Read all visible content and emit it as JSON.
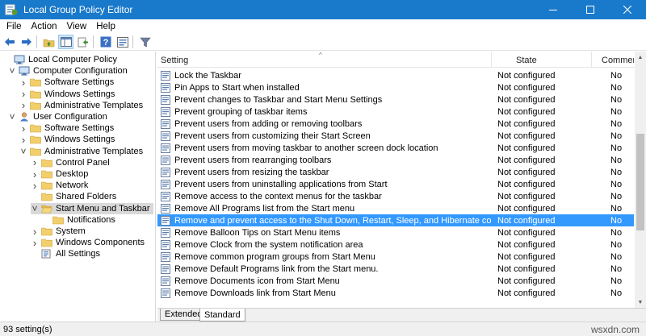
{
  "window": {
    "title": "Local Group Policy Editor"
  },
  "menu": [
    "File",
    "Action",
    "View",
    "Help"
  ],
  "toolbar_icons": [
    "back-icon",
    "forward-icon",
    "folder-up-icon",
    "show-hide-tree-icon",
    "export-list-icon",
    "help-icon",
    "properties-icon",
    "filter-icon"
  ],
  "tree": [
    {
      "label": "Local Computer Policy",
      "level": 0,
      "arrow": "",
      "icon": "computer",
      "selected": false
    },
    {
      "label": "Computer Configuration",
      "level": 1,
      "arrow": "open",
      "icon": "computer",
      "selected": false
    },
    {
      "label": "Software Settings",
      "level": 2,
      "arrow": "closed",
      "icon": "folder",
      "selected": false
    },
    {
      "label": "Windows Settings",
      "level": 2,
      "arrow": "closed",
      "icon": "folder",
      "selected": false
    },
    {
      "label": "Administrative Templates",
      "level": 2,
      "arrow": "closed",
      "icon": "folder",
      "selected": false
    },
    {
      "label": "User Configuration",
      "level": 1,
      "arrow": "open",
      "icon": "user",
      "selected": false
    },
    {
      "label": "Software Settings",
      "level": 2,
      "arrow": "closed",
      "icon": "folder",
      "selected": false
    },
    {
      "label": "Windows Settings",
      "level": 2,
      "arrow": "closed",
      "icon": "folder",
      "selected": false
    },
    {
      "label": "Administrative Templates",
      "level": 2,
      "arrow": "open",
      "icon": "folder",
      "selected": false
    },
    {
      "label": "Control Panel",
      "level": 3,
      "arrow": "closed",
      "icon": "folder",
      "selected": false
    },
    {
      "label": "Desktop",
      "level": 3,
      "arrow": "closed",
      "icon": "folder",
      "selected": false
    },
    {
      "label": "Network",
      "level": 3,
      "arrow": "closed",
      "icon": "folder",
      "selected": false
    },
    {
      "label": "Shared Folders",
      "level": 3,
      "arrow": "",
      "icon": "folder",
      "selected": false
    },
    {
      "label": "Start Menu and Taskbar",
      "level": 3,
      "arrow": "open",
      "icon": "folder-open",
      "selected": true
    },
    {
      "label": "Notifications",
      "level": 4,
      "arrow": "",
      "icon": "folder",
      "selected": false
    },
    {
      "label": "System",
      "level": 3,
      "arrow": "closed",
      "icon": "folder",
      "selected": false
    },
    {
      "label": "Windows Components",
      "level": 3,
      "arrow": "closed",
      "icon": "folder",
      "selected": false
    },
    {
      "label": "All Settings",
      "level": 3,
      "arrow": "",
      "icon": "all-settings",
      "selected": false
    }
  ],
  "columns": {
    "setting": "Setting",
    "state": "State",
    "comment": "Commen"
  },
  "rows": [
    {
      "setting": "Lock the Taskbar",
      "state": "Not configured",
      "comment": "No",
      "selected": false
    },
    {
      "setting": "Pin Apps to Start when installed",
      "state": "Not configured",
      "comment": "No",
      "selected": false
    },
    {
      "setting": "Prevent changes to Taskbar and Start Menu Settings",
      "state": "Not configured",
      "comment": "No",
      "selected": false
    },
    {
      "setting": "Prevent grouping of taskbar items",
      "state": "Not configured",
      "comment": "No",
      "selected": false
    },
    {
      "setting": "Prevent users from adding or removing toolbars",
      "state": "Not configured",
      "comment": "No",
      "selected": false
    },
    {
      "setting": "Prevent users from customizing their Start Screen",
      "state": "Not configured",
      "comment": "No",
      "selected": false
    },
    {
      "setting": "Prevent users from moving taskbar to another screen dock location",
      "state": "Not configured",
      "comment": "No",
      "selected": false
    },
    {
      "setting": "Prevent users from rearranging toolbars",
      "state": "Not configured",
      "comment": "No",
      "selected": false
    },
    {
      "setting": "Prevent users from resizing the taskbar",
      "state": "Not configured",
      "comment": "No",
      "selected": false
    },
    {
      "setting": "Prevent users from uninstalling applications from Start",
      "state": "Not configured",
      "comment": "No",
      "selected": false
    },
    {
      "setting": "Remove access to the context menus for the taskbar",
      "state": "Not configured",
      "comment": "No",
      "selected": false
    },
    {
      "setting": "Remove All Programs list from the Start menu",
      "state": "Not configured",
      "comment": "No",
      "selected": false
    },
    {
      "setting": "Remove and prevent access to the Shut Down, Restart, Sleep, and Hibernate commands",
      "state": "Not configured",
      "comment": "No",
      "selected": true
    },
    {
      "setting": "Remove Balloon Tips on Start Menu items",
      "state": "Not configured",
      "comment": "No",
      "selected": false
    },
    {
      "setting": "Remove Clock from the system notification area",
      "state": "Not configured",
      "comment": "No",
      "selected": false
    },
    {
      "setting": "Remove common program groups from Start Menu",
      "state": "Not configured",
      "comment": "No",
      "selected": false
    },
    {
      "setting": "Remove Default Programs link from the Start menu.",
      "state": "Not configured",
      "comment": "No",
      "selected": false
    },
    {
      "setting": "Remove Documents icon from Start Menu",
      "state": "Not configured",
      "comment": "No",
      "selected": false
    },
    {
      "setting": "Remove Downloads link from Start Menu",
      "state": "Not configured",
      "comment": "No",
      "selected": false
    }
  ],
  "tabs": [
    "Extended",
    "Standard"
  ],
  "status": "93 setting(s)",
  "watermark": "wsxdn.com",
  "colors": {
    "titlebar": "#1979ca",
    "selection": "#3399ff",
    "tree_selection": "#d9d9d9"
  }
}
